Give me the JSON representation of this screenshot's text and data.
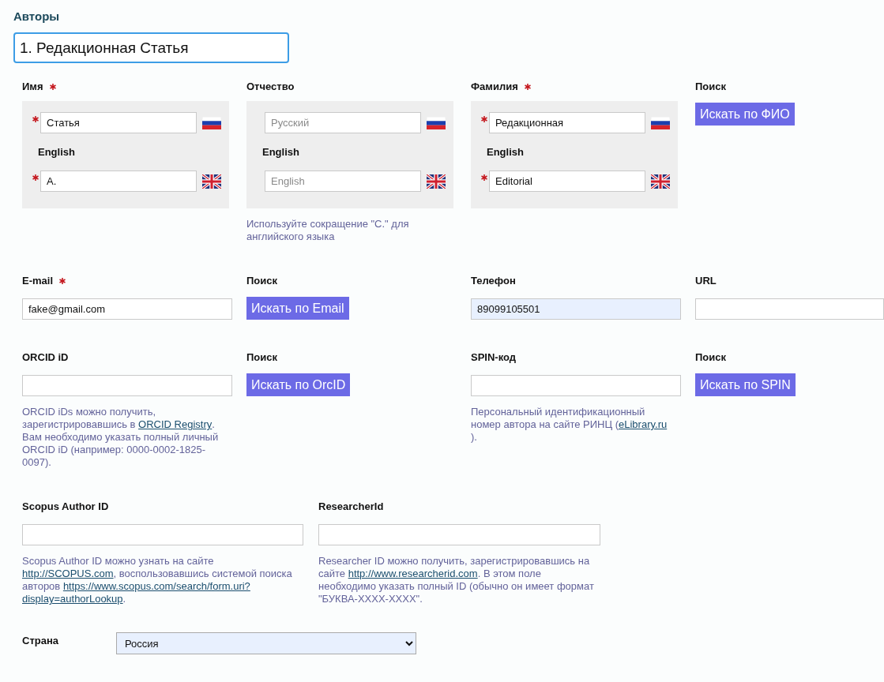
{
  "section_title": "Авторы",
  "author_title": "1. Редакционная Статья",
  "name_fields": [
    {
      "label": "Имя",
      "required": true,
      "russian": {
        "value": "Статья",
        "required": true
      },
      "english_label": "English",
      "english": {
        "value": "A.",
        "required": true
      }
    },
    {
      "label": "Отчество",
      "required": false,
      "russian": {
        "placeholder": "Русский",
        "required": false
      },
      "english_label": "English",
      "english": {
        "placeholder": "English",
        "required": false
      },
      "hint": [
        {
          "kind": "text",
          "text": "Используйте сокращение \"C.\" для английского языка"
        }
      ]
    },
    {
      "label": "Фамилия",
      "required": true,
      "russian": {
        "value": "Редакционная",
        "required": true
      },
      "english_label": "English",
      "english": {
        "value": "Editorial",
        "required": true
      }
    },
    {
      "kind": "search",
      "label": "Поиск",
      "button": "Искать по ФИО"
    }
  ],
  "rows": [
    [
      {
        "kind": "field",
        "label": "E-mail",
        "required": true,
        "value": "fake@gmail.com",
        "autofilled": false
      },
      {
        "kind": "search",
        "label": "Поиск",
        "button": "Искать по Email"
      },
      {
        "kind": "field",
        "label": "Телефон",
        "required": false,
        "value": "89099105501",
        "autofilled": true
      },
      {
        "kind": "field",
        "label": "URL",
        "required": false,
        "autofilled": false
      }
    ],
    [
      {
        "kind": "field",
        "label": "ORCID iD",
        "required": false,
        "autofilled": false,
        "hint": [
          {
            "kind": "text",
            "text": "ORCID iDs можно получить, зарегистрировавшись в "
          },
          {
            "kind": "link",
            "text": "ORCID Registry"
          },
          {
            "kind": "text",
            "text": ". Вам необходимо указать полный личный ORCID iD (например: 0000-0002-1825-0097)."
          }
        ]
      },
      {
        "kind": "search",
        "label": "Поиск",
        "button": "Искать по OrcID"
      },
      {
        "kind": "field",
        "label": "SPIN-код",
        "required": false,
        "autofilled": false,
        "hint": [
          {
            "kind": "text",
            "text": "Персональный идентификационный номер автора на сайте РИНЦ ("
          },
          {
            "kind": "link",
            "text": "eLibrary.ru"
          },
          {
            "kind": "text",
            "text": ")."
          }
        ]
      },
      {
        "kind": "search",
        "label": "Поиск",
        "button": "Искать по SPIN"
      }
    ],
    [
      {
        "kind": "field",
        "label": "Scopus Author ID",
        "required": false,
        "autofilled": false,
        "hint": [
          {
            "kind": "text",
            "text": "Scopus Author ID можно узнать на сайте "
          },
          {
            "kind": "link",
            "text": "http://SCOPUS.com"
          },
          {
            "kind": "text",
            "text": ", воспользовавшись системой поиска авторов "
          },
          {
            "kind": "link",
            "text": "https://www.scopus.com/search/form.uri?"
          },
          {
            "kind": "link",
            "text": "display=authorLookup"
          },
          {
            "kind": "text",
            "text": "."
          }
        ]
      },
      {
        "kind": "field",
        "label": "ResearcherId",
        "required": false,
        "autofilled": false,
        "hint": [
          {
            "kind": "text",
            "text": "Researcher ID можно получить, зарегистрировавшись на сайте "
          },
          {
            "kind": "link",
            "text": "http://www.researcherid.com"
          },
          {
            "kind": "text",
            "text": ". В этом поле необходимо указать полный ID (обычно он имеет формат \"БУКВА-XXXX-XXXX\"."
          }
        ]
      }
    ]
  ],
  "country": {
    "label": "Страна",
    "value": "Россия",
    "autofilled": true
  }
}
